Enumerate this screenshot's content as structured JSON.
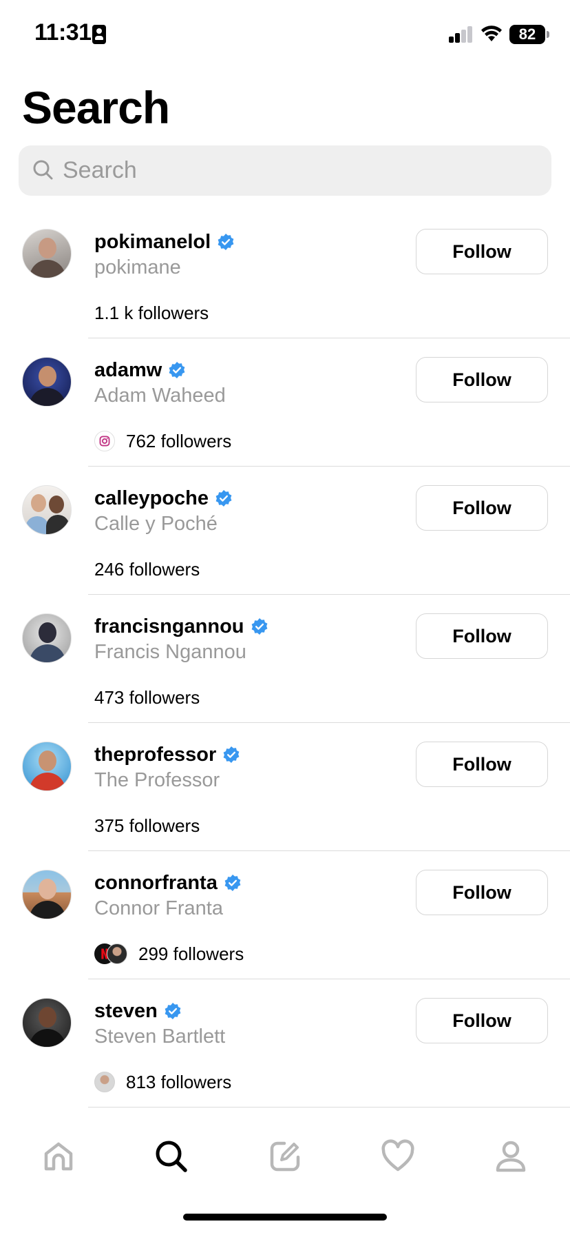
{
  "status_bar": {
    "time": "11:31",
    "battery": "82"
  },
  "page": {
    "title": "Search"
  },
  "search": {
    "placeholder": "Search",
    "value": ""
  },
  "results": [
    {
      "username": "pokimanelol",
      "full_name": "pokimane",
      "followers": "1.1 k followers",
      "follow_label": "Follow",
      "verified": true,
      "mutual_icons": []
    },
    {
      "username": "adamw",
      "full_name": "Adam Waheed",
      "followers": "762 followers",
      "follow_label": "Follow",
      "verified": true,
      "mutual_icons": [
        "instagram-icon"
      ]
    },
    {
      "username": "calleypoche",
      "full_name": "Calle y Poché",
      "followers": "246 followers",
      "follow_label": "Follow",
      "verified": true,
      "mutual_icons": []
    },
    {
      "username": "francisngannou",
      "full_name": "Francis Ngannou",
      "followers": "473 followers",
      "follow_label": "Follow",
      "verified": true,
      "mutual_icons": []
    },
    {
      "username": "theprofessor",
      "full_name": "The Professor",
      "followers": "375 followers",
      "follow_label": "Follow",
      "verified": true,
      "mutual_icons": []
    },
    {
      "username": "connorfranta",
      "full_name": "Connor Franta",
      "followers": "299 followers",
      "follow_label": "Follow",
      "verified": true,
      "mutual_icons": [
        "netflix-icon",
        "mutual-avatar"
      ]
    },
    {
      "username": "steven",
      "full_name": "Steven Bartlett",
      "followers": "813 followers",
      "follow_label": "Follow",
      "verified": true,
      "mutual_icons": [
        "mutual-avatar"
      ]
    }
  ],
  "tab_bar": {
    "tabs": [
      {
        "icon": "home-icon",
        "active": false
      },
      {
        "icon": "search-icon",
        "active": true
      },
      {
        "icon": "compose-icon",
        "active": false
      },
      {
        "icon": "heart-icon",
        "active": false
      },
      {
        "icon": "profile-icon",
        "active": false
      }
    ]
  },
  "colors": {
    "verified": "#3897f0",
    "muted_text": "#999999",
    "divider": "#dbdbdb",
    "search_bg": "#efefef",
    "inactive_icon": "#b8b8b8"
  }
}
